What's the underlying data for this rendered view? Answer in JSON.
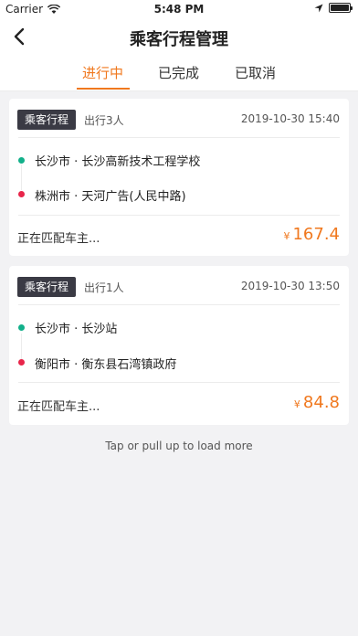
{
  "status_bar": {
    "carrier": "Carrier",
    "time": "5:48 PM"
  },
  "nav": {
    "title": "乘客行程管理"
  },
  "tabs": [
    {
      "label": "进行中",
      "active": true
    },
    {
      "label": "已完成",
      "active": false
    },
    {
      "label": "已取消",
      "active": false
    }
  ],
  "trips": [
    {
      "tag": "乘客行程",
      "people": "出行3人",
      "datetime": "2019-10-30 15:40",
      "from": "长沙市 · 长沙高新技术工程学校",
      "to": "株洲市 · 天河广告(人民中路)",
      "status": "正在匹配车主...",
      "currency": "¥",
      "price": "167.4"
    },
    {
      "tag": "乘客行程",
      "people": "出行1人",
      "datetime": "2019-10-30 13:50",
      "from": "长沙市 · 长沙站",
      "to": "衡阳市 · 衡东县石湾镇政府",
      "status": "正在匹配车主...",
      "currency": "¥",
      "price": "84.8"
    }
  ],
  "load_more": "Tap or pull up to load more",
  "colors": {
    "accent": "#f0781e",
    "origin_dot": "#12b08a",
    "destination_dot": "#e8254a",
    "tag_bg": "#3a3a44"
  }
}
